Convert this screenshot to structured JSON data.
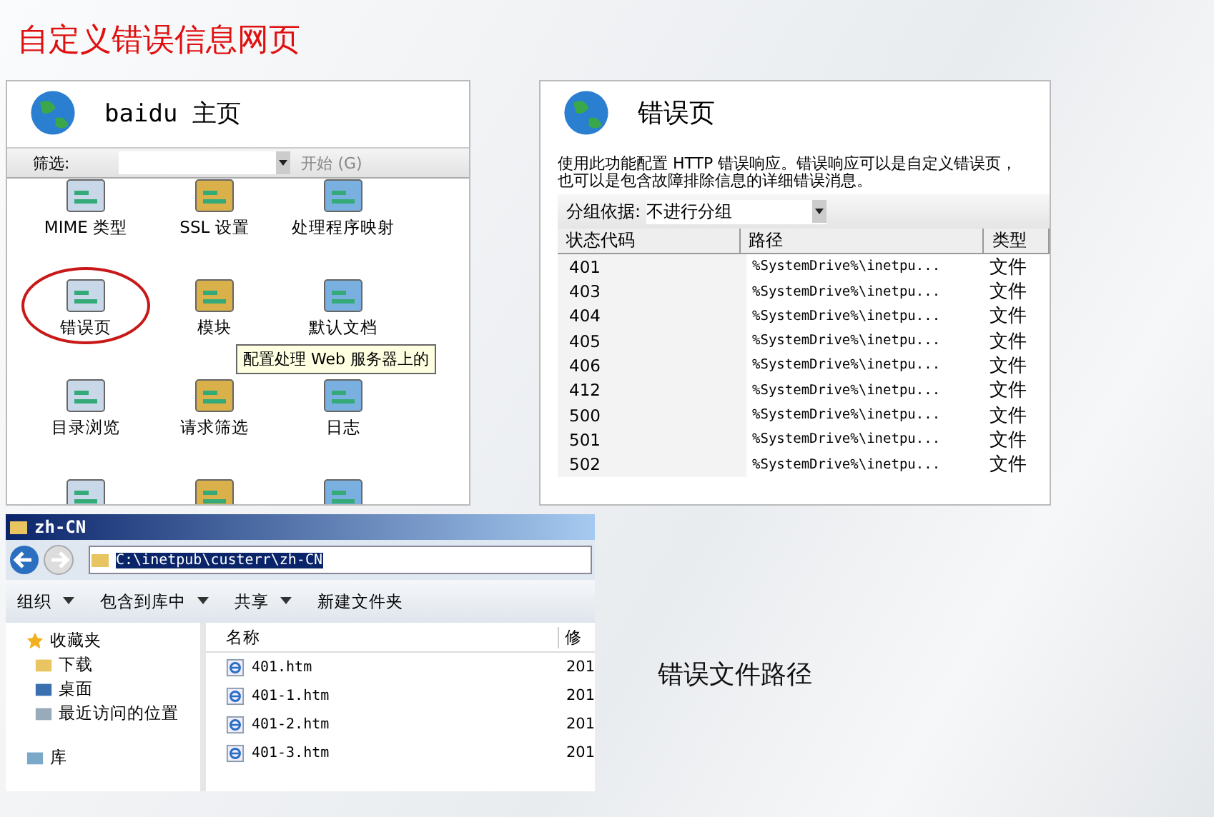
{
  "slide_title": "自定义错误信息网页",
  "iis_home": {
    "title": "baidu 主页",
    "filter_label": "筛选:",
    "start_button": "开始 (G)",
    "features": [
      {
        "label": "MIME 类型",
        "circled": false
      },
      {
        "label": "SSL 设置",
        "circled": false
      },
      {
        "label": "处理程序映射",
        "circled": false
      },
      {
        "label": "错误页",
        "circled": true
      },
      {
        "label": "模块",
        "circled": false
      },
      {
        "label": "默认文档",
        "circled": false
      },
      {
        "label": "目录浏览",
        "circled": false
      },
      {
        "label": "请求筛选",
        "circled": false
      },
      {
        "label": "日志",
        "circled": false
      },
      {
        "circled": false
      },
      {
        "circled": false
      },
      {
        "circled": false
      }
    ],
    "tooltip": "配置处理 Web 服务器上的"
  },
  "error_pages": {
    "title": "错误页",
    "description": "使用此功能配置 HTTP 错误响应。错误响应可以是自定义错误页，也可以是包含故障排除信息的详细错误消息。",
    "group_label": "分组依据:",
    "group_value": "不进行分组",
    "columns": [
      "状态代码",
      "路径",
      "类型"
    ],
    "rows": [
      {
        "code": "401",
        "path": "%SystemDrive%\\inetpu...",
        "type": "文件"
      },
      {
        "code": "403",
        "path": "%SystemDrive%\\inetpu...",
        "type": "文件"
      },
      {
        "code": "404",
        "path": "%SystemDrive%\\inetpu...",
        "type": "文件"
      },
      {
        "code": "405",
        "path": "%SystemDrive%\\inetpu...",
        "type": "文件"
      },
      {
        "code": "406",
        "path": "%SystemDrive%\\inetpu...",
        "type": "文件"
      },
      {
        "code": "412",
        "path": "%SystemDrive%\\inetpu...",
        "type": "文件"
      },
      {
        "code": "500",
        "path": "%SystemDrive%\\inetpu...",
        "type": "文件"
      },
      {
        "code": "501",
        "path": "%SystemDrive%\\inetpu...",
        "type": "文件"
      },
      {
        "code": "502",
        "path": "%SystemDrive%\\inetpu...",
        "type": "文件"
      }
    ]
  },
  "explorer": {
    "title": "zh-CN",
    "address": "C:\\inetpub\\custerr\\zh-CN",
    "toolbar": [
      {
        "label": "组织",
        "dropdown": true
      },
      {
        "label": "包含到库中",
        "dropdown": true
      },
      {
        "label": "共享",
        "dropdown": true
      },
      {
        "label": "新建文件夹",
        "dropdown": false
      }
    ],
    "nav": [
      {
        "label": "收藏夹",
        "children": [
          {
            "label": "下载"
          },
          {
            "label": "桌面"
          },
          {
            "label": "最近访问的位置"
          }
        ]
      },
      {
        "label": "库"
      }
    ],
    "columns": [
      "名称",
      "修"
    ],
    "files": [
      {
        "name": "401.htm",
        "modified": "201"
      },
      {
        "name": "401-1.htm",
        "modified": "201"
      },
      {
        "name": "401-2.htm",
        "modified": "201"
      },
      {
        "name": "401-3.htm",
        "modified": "201"
      }
    ]
  },
  "caption": "错误文件路径"
}
